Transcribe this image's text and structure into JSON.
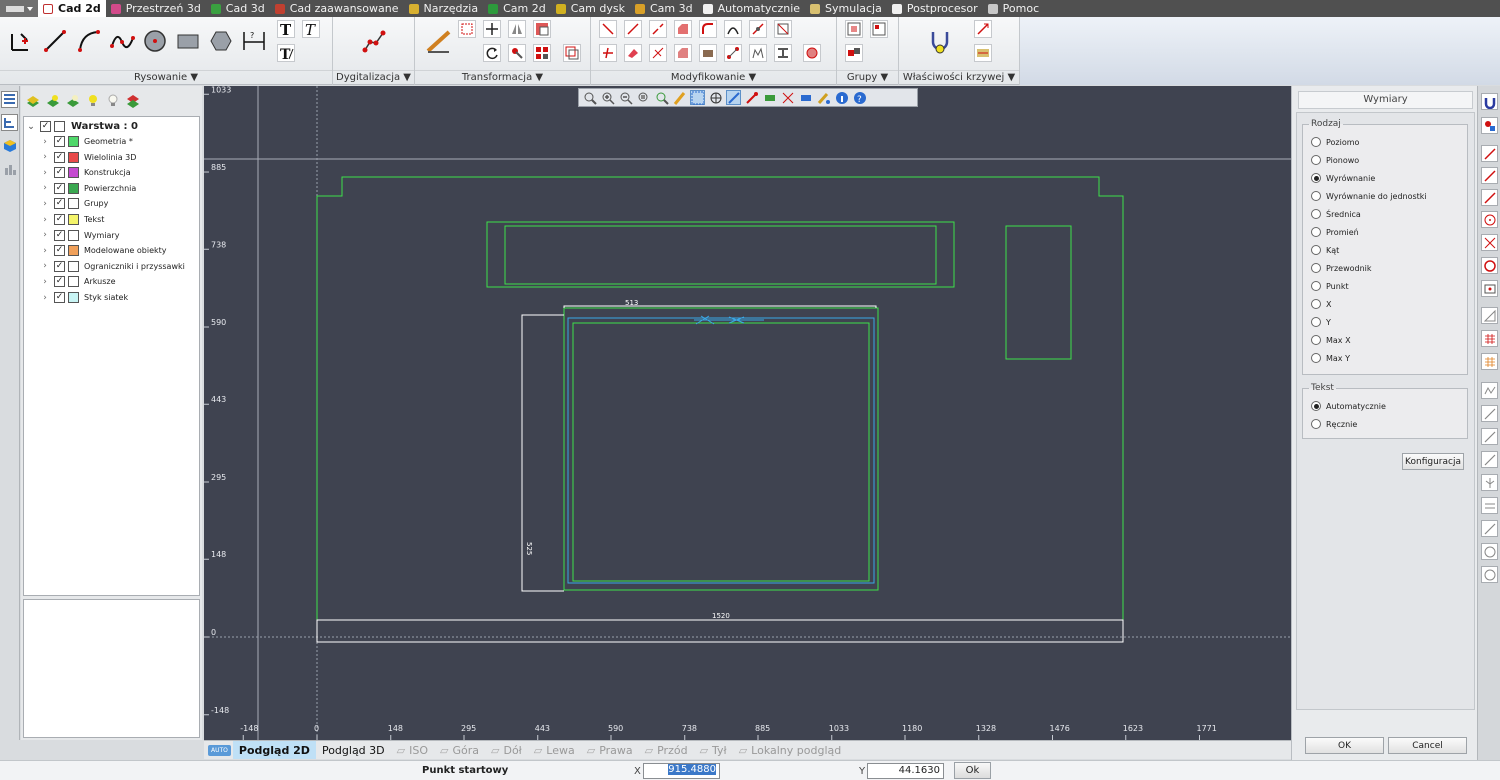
{
  "menu": {
    "tabs": [
      {
        "label": "Cad 2d",
        "active": true,
        "color": "#e04040"
      },
      {
        "label": "Przestrzeń 3d",
        "color": "#d24a8a"
      },
      {
        "label": "Cad 3d",
        "color": "#3aa040"
      },
      {
        "label": "Cad zaawansowane",
        "color": "#c04030"
      },
      {
        "label": "Narzędzia",
        "color": "#d8b030"
      },
      {
        "label": "Cam 2d",
        "color": "#2d9a3c"
      },
      {
        "label": "Cam dysk",
        "color": "#d0b020"
      },
      {
        "label": "Cam 3d",
        "color": "#d8a028"
      },
      {
        "label": "Automatycznie",
        "color": "#f0f0f0"
      },
      {
        "label": "Symulacja",
        "color": "#d8c070"
      },
      {
        "label": "Postprocesor",
        "color": "#f0f0f0"
      },
      {
        "label": "Pomoc",
        "color": "#c8c8c8"
      }
    ]
  },
  "ribbon": {
    "groups": {
      "rysowanie": "Rysowanie ▼",
      "dygitalizacja": "Dygitalizacja ▼",
      "transformacja": "Transformacja ▼",
      "modyfikowanie": "Modyfikowanie ▼",
      "grupy": "Grupy ▼",
      "wlasciwosci": "Właściwości krzywej ▼"
    }
  },
  "layers": {
    "root": "Warstwa : 0",
    "items": [
      {
        "label": "Geometria *",
        "color": "#4fd86a"
      },
      {
        "label": "Wielolinia 3D",
        "color": "#e84a4a"
      },
      {
        "label": "Konstrukcja",
        "color": "#c44ad0"
      },
      {
        "label": "Powierzchnia",
        "color": "#3aa850"
      },
      {
        "label": "Grupy",
        "color": "#ffffff"
      },
      {
        "label": "Tekst",
        "color": "#f4f46a"
      },
      {
        "label": "Wymiary",
        "color": "#ffffff"
      },
      {
        "label": "Modelowane obiekty",
        "color": "#f0a05a"
      },
      {
        "label": "Ograniczniki i przyssawki",
        "color": "#ffffff"
      },
      {
        "label": "Arkusze",
        "color": "#ffffff"
      },
      {
        "label": "Styk siatek",
        "color": "#c8f4f4"
      }
    ]
  },
  "canvas": {
    "y_ticks": [
      "1033",
      "885",
      "738",
      "590",
      "443",
      "295",
      "148",
      "0",
      "-148"
    ],
    "x_ticks": [
      "-148",
      "0",
      "148",
      "295",
      "443",
      "590",
      "738",
      "885",
      "1033",
      "1180",
      "1328",
      "1476",
      "1623",
      "1771"
    ],
    "dims": {
      "width_top": "513",
      "height_left": "525",
      "bottom_width": "1520"
    }
  },
  "view_tabs": {
    "auto": "AUTO",
    "tabs": [
      {
        "label": "Podgląd 2D",
        "state": "active"
      },
      {
        "label": "Podgląd 3D",
        "state": "on"
      },
      {
        "label": "ISO",
        "state": "off"
      },
      {
        "label": "Góra",
        "state": "off"
      },
      {
        "label": "Dół",
        "state": "off"
      },
      {
        "label": "Lewa",
        "state": "off"
      },
      {
        "label": "Prawa",
        "state": "off"
      },
      {
        "label": "Przód",
        "state": "off"
      },
      {
        "label": "Tył",
        "state": "off"
      },
      {
        "label": "Lokalny podgląd",
        "state": "off"
      }
    ]
  },
  "status": {
    "label": "Punkt startowy",
    "x_label": "X",
    "x_value": "915.4880",
    "y_label": "Y",
    "y_value": "44.1630",
    "ok": "Ok"
  },
  "dim_panel": {
    "title": "Wymiary",
    "rodzaj_legend": "Rodzaj",
    "rodzaj": [
      {
        "label": "Poziomo",
        "checked": false
      },
      {
        "label": "Pionowo",
        "checked": false
      },
      {
        "label": "Wyrównanie",
        "checked": true
      },
      {
        "label": "Wyrównanie do jednostki",
        "checked": false
      },
      {
        "label": "Średnica",
        "checked": false
      },
      {
        "label": "Promień",
        "checked": false
      },
      {
        "label": "Kąt",
        "checked": false
      },
      {
        "label": "Przewodnik",
        "checked": false
      },
      {
        "label": "Punkt",
        "checked": false
      },
      {
        "label": "X",
        "checked": false
      },
      {
        "label": "Y",
        "checked": false
      },
      {
        "label": "Max X",
        "checked": false
      },
      {
        "label": "Max Y",
        "checked": false
      }
    ],
    "tekst_legend": "Tekst",
    "tekst": [
      {
        "label": "Automatycznie",
        "checked": true
      },
      {
        "label": "Ręcznie",
        "checked": false
      }
    ],
    "config_button": "Konfiguracja",
    "ok_button": "OK",
    "cancel_button": "Cancel"
  },
  "colors": {
    "canvas_bg": "#3f4350",
    "geometry": "#3ee04a",
    "dimension": "#ffffff",
    "highlight": "#3aa8e6"
  }
}
